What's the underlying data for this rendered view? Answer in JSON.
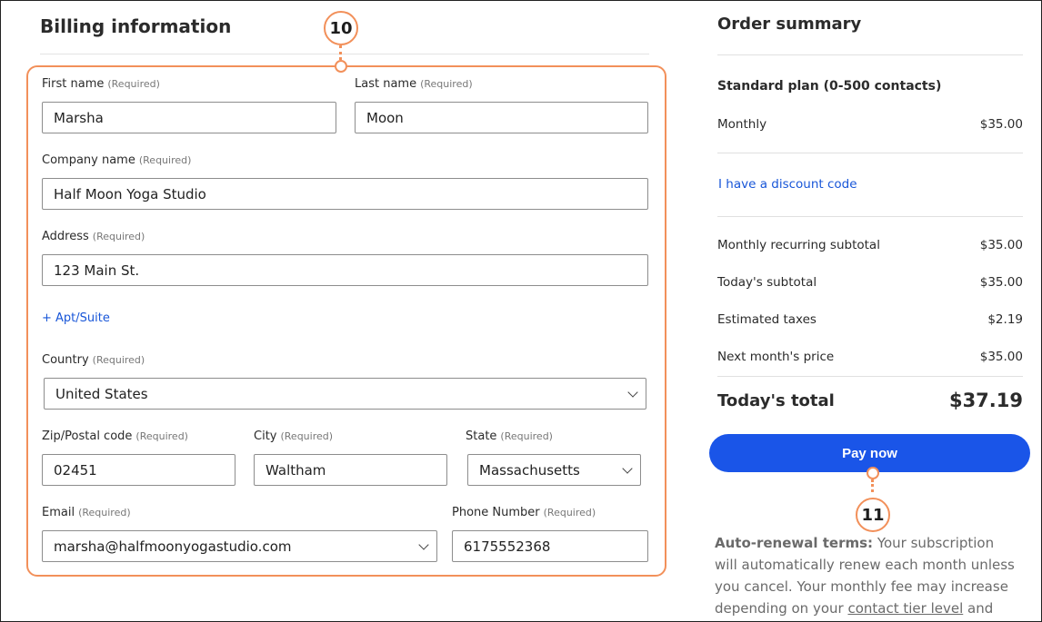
{
  "billing": {
    "title": "Billing information",
    "required_text": "(Required)",
    "first_name": {
      "label": "First name",
      "value": "Marsha"
    },
    "last_name": {
      "label": "Last name",
      "value": "Moon"
    },
    "company": {
      "label": "Company name",
      "value": "Half Moon Yoga Studio"
    },
    "address": {
      "label": "Address",
      "value": "123 Main St."
    },
    "apt_link": "+ Apt/Suite",
    "country": {
      "label": "Country",
      "value": "United States"
    },
    "zip": {
      "label": "Zip/Postal code",
      "value": "02451"
    },
    "city": {
      "label": "City",
      "value": "Waltham"
    },
    "state": {
      "label": "State",
      "value": "Massachusetts"
    },
    "email": {
      "label": "Email",
      "value": "marsha@halfmoonyogastudio.com"
    },
    "phone": {
      "label": "Phone Number",
      "value": "6175552368"
    }
  },
  "summary": {
    "title": "Order summary",
    "plan": "Standard plan (0-500 contacts)",
    "monthly_label": "Monthly",
    "monthly_value": "$35.00",
    "discount_link": "I have a discount code",
    "recurring_label": "Monthly recurring subtotal",
    "recurring_value": "$35.00",
    "today_sub_label": "Today's subtotal",
    "today_sub_value": "$35.00",
    "taxes_label": "Estimated taxes",
    "taxes_value": "$2.19",
    "next_label": "Next month's price",
    "next_value": "$35.00",
    "total_label": "Today's total",
    "total_value": "$37.19",
    "pay_label": "Pay now",
    "terms_bold": "Auto-renewal terms:",
    "terms_text_1": " Your subscription will automatically renew each month unless you cancel. Your monthly fee may increase depending on your ",
    "terms_link": "contact tier level",
    "terms_text_2": " and"
  },
  "callouts": {
    "billing_number": "10",
    "pay_number": "11"
  },
  "colors": {
    "accent": "#f2905a",
    "primary": "#1a55e8",
    "link": "#1856d8"
  }
}
